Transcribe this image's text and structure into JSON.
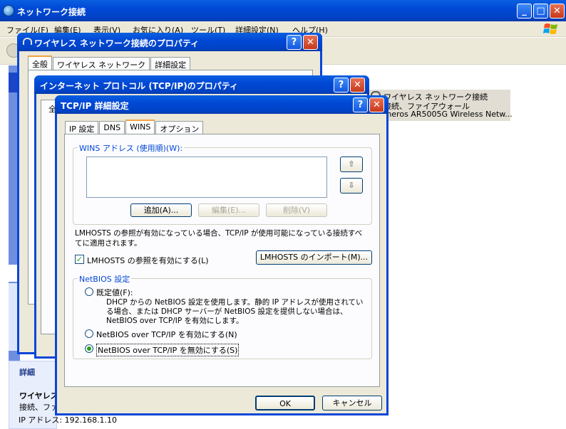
{
  "explorer": {
    "title": "ネットワーク接続",
    "menu": [
      "ファイル(F)",
      "編集(E)",
      "表示(V)",
      "お気に入り(A)",
      "ツール(T)",
      "詳細設定(N)",
      "ヘルプ(H)"
    ],
    "connection": {
      "name": "ワイヤレス ネットワーク接続",
      "status": "接続、ファイアウォール",
      "device": "theros AR5005G Wireless Netw..."
    },
    "details": {
      "heading": "詳細",
      "name": "ワイヤレス",
      "status": "接続、ファ",
      "ip": "IP アドレス: 192.168.1.10"
    }
  },
  "wireless_props": {
    "title": "ワイヤレス ネットワーク接続のプロパティ",
    "tabs": [
      "全般",
      "ワイヤレス ネットワーク",
      "詳細設定"
    ]
  },
  "tcpip_props": {
    "title": "インターネット プロトコル (TCP/IP)のプロパティ",
    "tab_stub": "全"
  },
  "adv": {
    "title": "TCP/IP 詳細設定",
    "tabs": [
      "IP 設定",
      "DNS",
      "WINS",
      "オプション"
    ],
    "active_tab": 2,
    "wins_group_label": "WINS アドレス (使用順)(W):",
    "wins_addresses": [],
    "add_btn": "追加(A)...",
    "edit_btn": "編集(E)...",
    "delete_btn": "削除(V)",
    "up_arrow": "⇧",
    "down_arrow": "⇩",
    "lmhosts_desc_1": "LMHOSTS の参照が有効になっている場合、TCP/IP が使用可能になっている接続すべ",
    "lmhosts_desc_2": "てに適用されます。",
    "lmhosts_check_label": "LMHOSTS の参照を有効にする(L)",
    "lmhosts_checked": true,
    "import_btn": "LMHOSTS のインポート(M)...",
    "netbios_group": "NetBIOS 設定",
    "netbios_options": [
      {
        "label": "既定値(F):",
        "selected": false
      },
      {
        "label": "NetBIOS over TCP/IP を有効にする(N)",
        "selected": false
      },
      {
        "label": "NetBIOS over TCP/IP を無効にする(S)",
        "selected": true
      }
    ],
    "default_desc_1": "DHCP からの NetBIOS 設定を使用します。静的 IP アドレスが使用されてい",
    "default_desc_2": "る場合、または DHCP サーバーが NetBIOS 設定を提供しない場合は、",
    "default_desc_3": "NetBIOS over TCP/IP を有効にします。",
    "ok_btn": "OK",
    "cancel_btn": "キャンセル"
  },
  "window_buttons": {
    "minimize": "_",
    "maximize": "□",
    "close": "✕",
    "help": "?"
  },
  "colors": {
    "title_blue": "#0049d6",
    "dialog_face": "#ece9d8",
    "group_label": "#0046d5",
    "close_red": "#c6391a"
  }
}
